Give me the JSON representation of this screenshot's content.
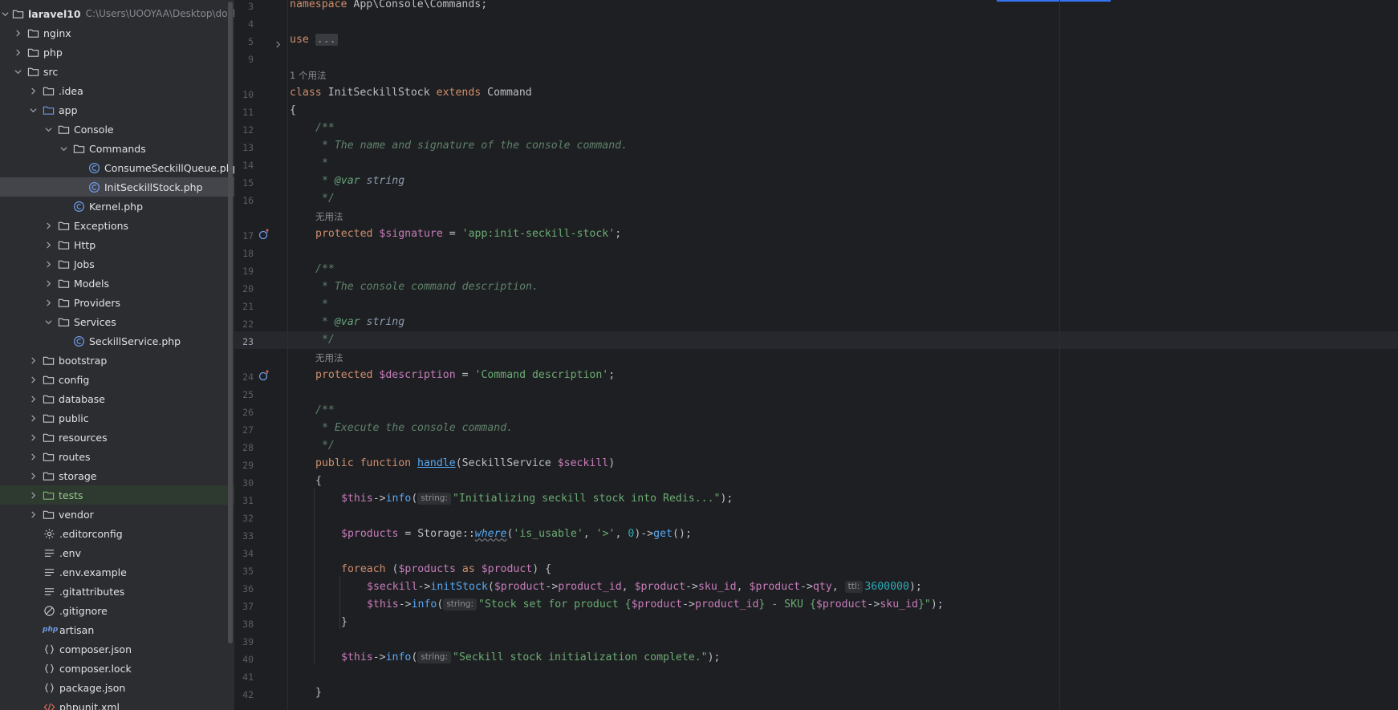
{
  "project_tree": {
    "root": {
      "label": "laravel10",
      "path": "C:\\Users\\UOOYAA\\Desktop\\docke"
    },
    "items": [
      {
        "label": "nginx"
      },
      {
        "label": "php"
      },
      {
        "label": "src"
      },
      {
        "label": ".idea"
      },
      {
        "label": "app"
      },
      {
        "label": "Console"
      },
      {
        "label": "Commands"
      },
      {
        "label": "ConsumeSeckillQueue.php"
      },
      {
        "label": "InitSeckillStock.php"
      },
      {
        "label": "Kernel.php"
      },
      {
        "label": "Exceptions"
      },
      {
        "label": "Http"
      },
      {
        "label": "Jobs"
      },
      {
        "label": "Models"
      },
      {
        "label": "Providers"
      },
      {
        "label": "Services"
      },
      {
        "label": "SeckillService.php"
      },
      {
        "label": "bootstrap"
      },
      {
        "label": "config"
      },
      {
        "label": "database"
      },
      {
        "label": "public"
      },
      {
        "label": "resources"
      },
      {
        "label": "routes"
      },
      {
        "label": "storage"
      },
      {
        "label": "tests"
      },
      {
        "label": "vendor"
      },
      {
        "label": ".editorconfig"
      },
      {
        "label": ".env"
      },
      {
        "label": ".env.example"
      },
      {
        "label": ".gitattributes"
      },
      {
        "label": ".gitignore"
      },
      {
        "label": "artisan",
        "tag": "php"
      },
      {
        "label": "composer.json"
      },
      {
        "label": "composer.lock"
      },
      {
        "label": "package.json"
      },
      {
        "label": "phpunit.xml"
      }
    ]
  },
  "editor": {
    "line_numbers": [
      "3",
      "4",
      "5",
      "9",
      "10",
      "11",
      "12",
      "13",
      "14",
      "15",
      "16",
      "17",
      "18",
      "19",
      "20",
      "21",
      "22",
      "23",
      "24",
      "25",
      "26",
      "27",
      "28",
      "29",
      "30",
      "31",
      "32",
      "33",
      "34",
      "35",
      "36",
      "37",
      "38",
      "39",
      "40",
      "41",
      "42"
    ],
    "usage_hints": [
      "1 个用法",
      "无用法",
      "无用法"
    ],
    "code": {
      "ns_kw": "namespace",
      "ns_name": " App\\Console\\Commands;",
      "use_kw": "use",
      "use_fold": "...",
      "class_kw": "class",
      "class_name": " InitSeckillStock ",
      "extends_kw": "extends",
      "parent": " Command",
      "brace_open": "{",
      "brace_close": "}",
      "doc_open": "/**",
      "doc_close": " */",
      "doc_star": " *",
      "doc1": " * The name and signature of the console command.",
      "doc_var_star": " * ",
      "doc_var_tag": "@var",
      "doc_var_type": " string",
      "prot": "protected",
      "sig_var": " $signature",
      "eq": " = ",
      "sig_val": "'app:init-seckill-stock'",
      "semi": ";",
      "doc2": " * The console command description.",
      "desc_var": " $description",
      "desc_val": "'Command description'",
      "doc3": " * Execute the console command.",
      "pub": "public",
      "func": " function ",
      "handle": "handle",
      "paren_open": "(",
      "svc_type": "SeckillService ",
      "svc_var": "$seckill",
      "paren_close": ")",
      "this": "$this",
      "arrow": "->",
      "info": "info",
      "lp": "(",
      "inlay_string": "string:",
      "inlay_ttl": "ttl:",
      "msg1": "\"Initializing seckill stock into Redis...\"",
      "end": ");",
      "products": "$products",
      "storage": "Storage",
      "dcolon": "::",
      "where": "where",
      "w_a1": "'is_usable'",
      "comma": ", ",
      "w_a2": "'>'",
      "zero": "0",
      "get": "get",
      "get_end": "();",
      "foreach": "foreach",
      "lp2": " (",
      "as": " as ",
      "product": "$product",
      "rp_brace": ") {",
      "seckill": "$seckill",
      "initStock": "initStock",
      "product_id": "product_id",
      "sku_id": "sku_id",
      "qty": "qty",
      "ttl_val": "3600000",
      "msg2_a": "\"Stock set for product ",
      "lcb": "{",
      "rcb": "}",
      "msg2_b": " - SKU ",
      "msg2_c": "\"",
      "msg3": "\"Seckill stock initialization complete.\""
    }
  }
}
